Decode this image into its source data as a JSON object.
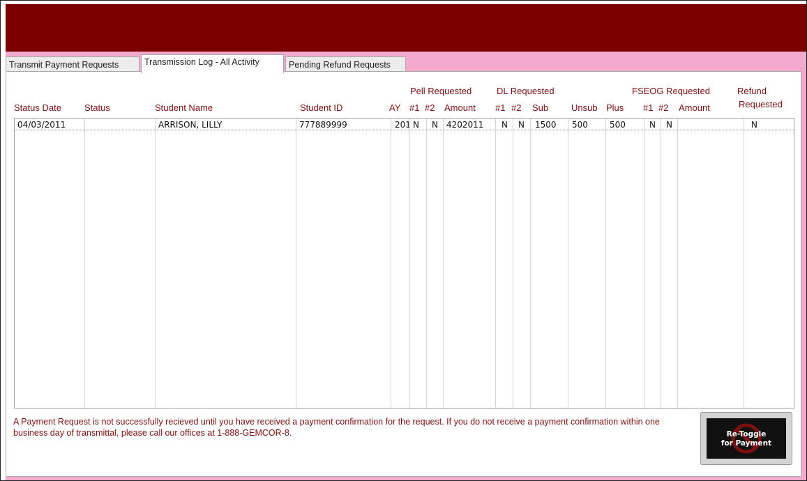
{
  "tabs": [
    {
      "label": "Transmit Payment Requests"
    },
    {
      "label": "Transmission Log - All Activity"
    },
    {
      "label": "Pending Refund Requests"
    }
  ],
  "headers": {
    "group_pell": "Pell Requested",
    "group_dl": "DL Requested",
    "group_fseog": "FSEOG Requested",
    "refund_1": "Refund",
    "refund_2": "Requested",
    "status_date": "Status Date",
    "status": "Status",
    "student_name": "Student Name",
    "student_id": "Student ID",
    "ay": "AY",
    "pell_1": "#1",
    "pell_2": "#2",
    "pell_amount": "Amount",
    "dl_1": "#1",
    "dl_2": "#2",
    "dl_sub": "Sub",
    "dl_unsub": "Unsub",
    "dl_plus": "Plus",
    "fseog_1": "#1",
    "fseog_2": "#2",
    "fseog_amount": "Amount"
  },
  "rows": [
    {
      "status_date": "04/03/2011",
      "status": "",
      "student_name": "ARRISON, LILLY",
      "student_id": "777889999",
      "ay": "201",
      "pell_1": "N",
      "pell_2": "N",
      "pell_amount": "4202011",
      "dl_1": "N",
      "dl_2": "N",
      "dl_sub": "1500",
      "dl_unsub": "500",
      "dl_plus": "500",
      "fseog_1": "N",
      "fseog_2": "N",
      "fseog_amount": "",
      "refund": "N"
    }
  ],
  "notice": "A Payment Request is not successfully recieved until you have received a payment confirmation for the request.  If you do not receive a payment confirmation within one business day of transmittal, please call our offices at 1-888-GEMCOR-8.",
  "retoggle_button": {
    "label": "Re-Toggle\nfor Payment"
  },
  "colors": {
    "banner": "#7b0000",
    "background_band": "#f4a9cf",
    "header_text": "#7b1010"
  }
}
